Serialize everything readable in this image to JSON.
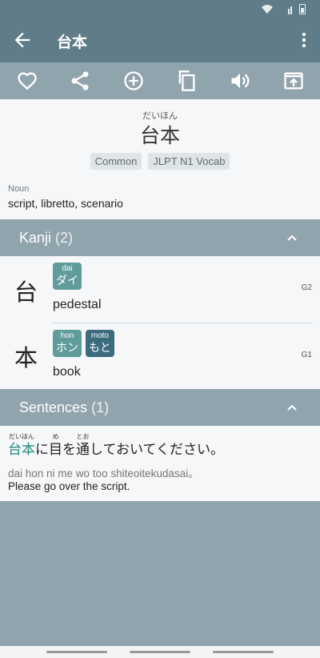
{
  "status_bar": {},
  "app_bar": {
    "title": "台本"
  },
  "word": {
    "furigana": "だいほん",
    "text": "台本",
    "tags": [
      "Common",
      "JLPT N1 Vocab"
    ],
    "part_of_speech": "Noun",
    "meaning": "script, libretto, scenario"
  },
  "kanji_section": {
    "title": "Kanji",
    "count": "(2)",
    "items": [
      {
        "char": "台",
        "readings": [
          {
            "romaji": "dai",
            "kana": "ダイ",
            "type": "on"
          }
        ],
        "meaning": "pedestal",
        "grade": "G2"
      },
      {
        "char": "本",
        "readings": [
          {
            "romaji": "hon",
            "kana": "ホン",
            "type": "on"
          },
          {
            "romaji": "moto",
            "kana": "もと",
            "type": "kun"
          }
        ],
        "meaning": "book",
        "grade": "G1"
      }
    ]
  },
  "sentences_section": {
    "title": "Sentences",
    "count": "(1)",
    "sentence": {
      "segments": [
        {
          "base": "台本",
          "ruby": "だいほん",
          "highlight": true
        },
        {
          "base": "に",
          "ruby": "",
          "highlight": false
        },
        {
          "base": "目",
          "ruby": "め",
          "highlight": false
        },
        {
          "base": "を",
          "ruby": "",
          "highlight": false
        },
        {
          "base": "通",
          "ruby": "とお",
          "highlight": false
        },
        {
          "base": "しておいてください。",
          "ruby": "",
          "highlight": false
        }
      ],
      "romaji": "dai hon ni me wo too shiteoitekudasai。",
      "english": "Please go over the script."
    }
  },
  "colors": {
    "app_bar": "#5f7c88",
    "toolbar": "#90a4ae",
    "on_reading": "#5f9c9a",
    "kun_reading": "#3d6b7e",
    "highlight": "#1e8a7e"
  },
  "icons": {
    "toolbar": [
      "heart-icon",
      "share-icon",
      "add-circle-icon",
      "copy-icon",
      "volume-icon",
      "open-in-app-icon"
    ]
  }
}
